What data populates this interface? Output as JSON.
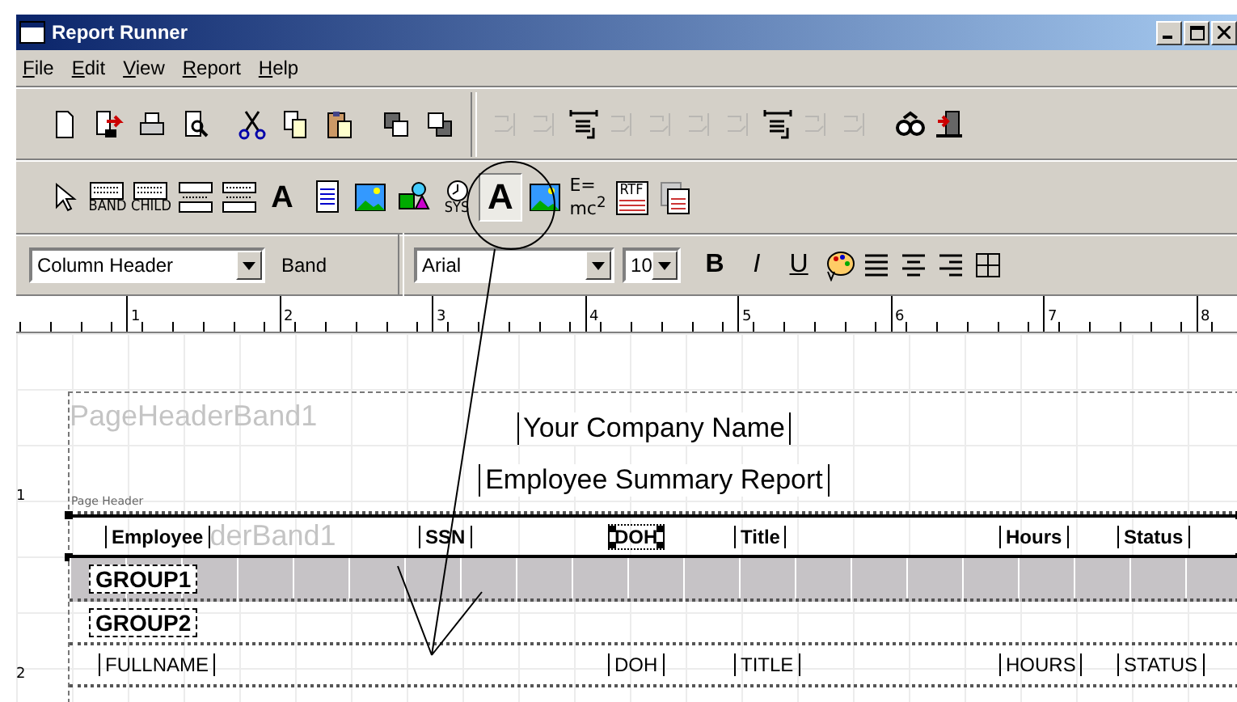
{
  "window": {
    "title": "Report Runner"
  },
  "menu": [
    {
      "label": "File"
    },
    {
      "label": "Edit"
    },
    {
      "label": "View"
    },
    {
      "label": "Report"
    },
    {
      "label": "Help"
    }
  ],
  "toolbar_main": [
    {
      "kind": "new",
      "disabled": false
    },
    {
      "kind": "open",
      "disabled": false
    },
    {
      "kind": "print",
      "disabled": false
    },
    {
      "kind": "preview",
      "disabled": false
    },
    {
      "kind": "cut",
      "disabled": false
    },
    {
      "kind": "copy",
      "disabled": false
    },
    {
      "kind": "paste",
      "disabled": false
    },
    {
      "kind": "front",
      "disabled": false
    },
    {
      "kind": "back",
      "disabled": false
    }
  ],
  "toolbar_layout": [
    {
      "kind": "align",
      "disabled": true
    },
    {
      "kind": "align",
      "disabled": true
    },
    {
      "kind": "space",
      "disabled": false
    },
    {
      "kind": "align",
      "disabled": true
    },
    {
      "kind": "align",
      "disabled": true
    },
    {
      "kind": "align",
      "disabled": true
    },
    {
      "kind": "align",
      "disabled": true
    },
    {
      "kind": "space",
      "disabled": false
    },
    {
      "kind": "align",
      "disabled": true
    },
    {
      "kind": "align",
      "disabled": true
    },
    {
      "kind": "glasses",
      "disabled": false
    },
    {
      "kind": "exit",
      "disabled": false
    }
  ],
  "toolbar_components": [
    {
      "kind": "pointer",
      "pressed": false
    },
    {
      "kind": "band",
      "label": "BAND",
      "pressed": false
    },
    {
      "kind": "band",
      "label": "CHILD",
      "pressed": false
    },
    {
      "kind": "group-header",
      "pressed": false
    },
    {
      "kind": "group-footer",
      "pressed": false
    },
    {
      "kind": "letter",
      "label": "A",
      "pressed": false
    },
    {
      "kind": "memo",
      "pressed": false
    },
    {
      "kind": "image",
      "pressed": false
    },
    {
      "kind": "shape",
      "pressed": false
    },
    {
      "kind": "clock",
      "label": "SYS",
      "pressed": false
    },
    {
      "kind": "db-letter",
      "label": "A",
      "pressed": true
    },
    {
      "kind": "db-image",
      "pressed": false
    },
    {
      "kind": "formula",
      "lines": [
        "E=",
        "mc$^{2}$"
      ],
      "pressed": false
    },
    {
      "kind": "rtf",
      "label": "RTF",
      "pressed": false
    },
    {
      "kind": "db-rtf",
      "pressed": false
    }
  ],
  "format_bar": {
    "band_select": {
      "value": "Column Header"
    },
    "band_label": "Band",
    "font_select": {
      "value": "Arial"
    },
    "size_select": {
      "value": "10"
    },
    "style_buttons": [
      {
        "kind": "bold",
        "label": "B"
      },
      {
        "kind": "italic",
        "label": "I"
      },
      {
        "kind": "underline",
        "label": "U"
      }
    ],
    "tools": [
      {
        "kind": "palette"
      },
      {
        "kind": "align-left"
      },
      {
        "kind": "align-center"
      },
      {
        "kind": "align-right"
      },
      {
        "kind": "frame"
      }
    ]
  },
  "ruler": {
    "numbers": [
      "1",
      "2",
      "3",
      "4",
      "5",
      "6",
      "7",
      "8"
    ]
  },
  "vertical_ruler": {
    "numbers": [
      "1",
      "2"
    ]
  },
  "report": {
    "bands": [
      {
        "kind": "page-header",
        "name": "PageHeaderBand1",
        "tag": "Page Header",
        "selected": false,
        "titles": [
          "Your Company Name",
          "Employee Summary Report"
        ]
      },
      {
        "kind": "column-header",
        "name": "derBand1",
        "selected": true,
        "fields": [
          {
            "text": "Employee",
            "selected": false
          },
          {
            "text": "SSN",
            "selected": false
          },
          {
            "text": "DOH",
            "selected": true
          },
          {
            "text": "Title",
            "selected": false
          },
          {
            "text": "Hours",
            "selected": false
          },
          {
            "text": "Status",
            "selected": false
          }
        ]
      },
      {
        "kind": "group",
        "shaded": true,
        "selected": false,
        "fields": [
          {
            "text": "GROUP1",
            "selected": false
          }
        ]
      },
      {
        "kind": "group",
        "shaded": false,
        "selected": false,
        "fields": [
          {
            "text": "GROUP2",
            "selected": false
          }
        ]
      },
      {
        "kind": "detail",
        "selected": false,
        "fields": [
          {
            "text": "FULLNAME",
            "selected": false
          },
          {
            "text": "DOH",
            "selected": false
          },
          {
            "text": "TITLE",
            "selected": false
          },
          {
            "text": "HOURS",
            "selected": false
          },
          {
            "text": "STATUS",
            "selected": false
          }
        ]
      }
    ]
  }
}
